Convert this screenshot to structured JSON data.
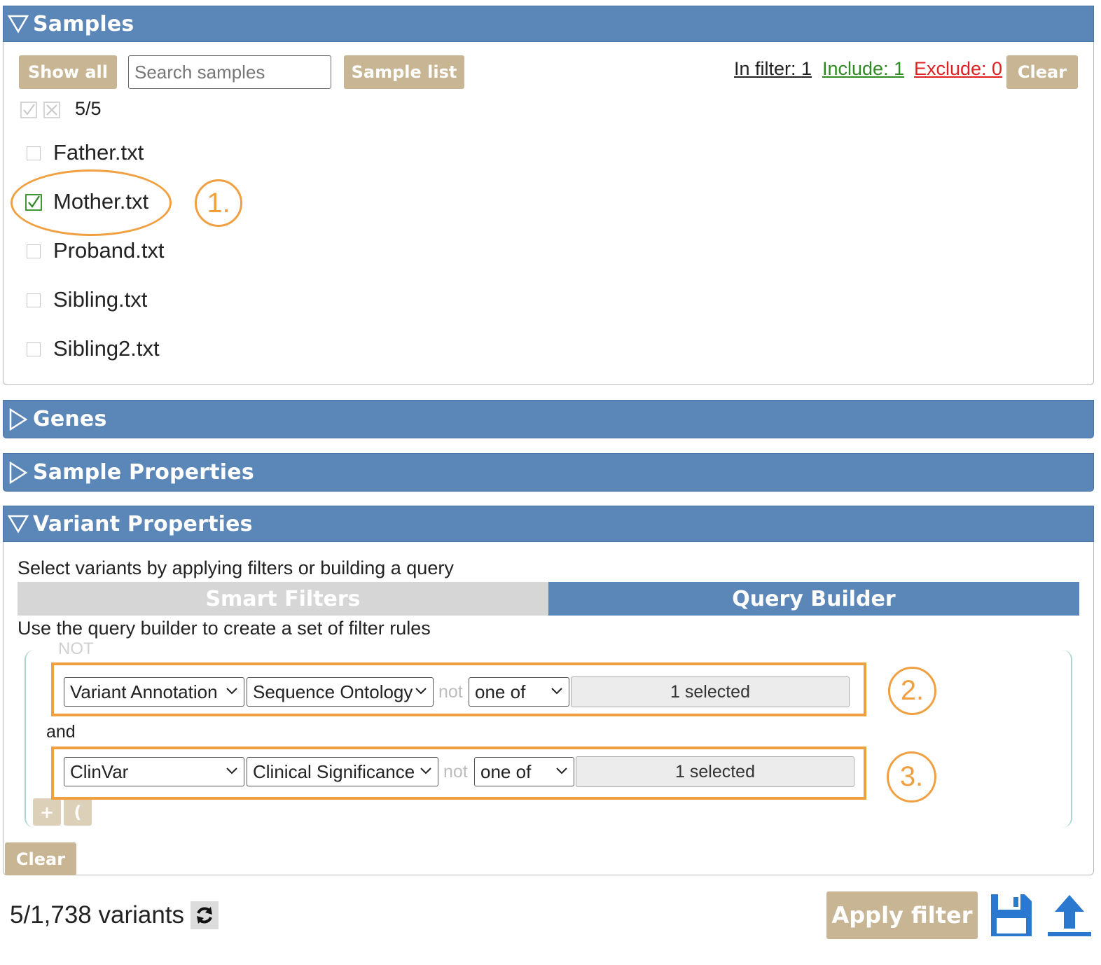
{
  "samples": {
    "title": "Samples",
    "show_all": "Show all",
    "search_placeholder": "Search samples",
    "sample_list": "Sample list",
    "in_filter": "In filter: 1",
    "include": "Include: 1",
    "exclude": "Exclude: 0",
    "clear": "Clear",
    "count": "5/5",
    "items": [
      {
        "label": "Father.txt",
        "checked": false
      },
      {
        "label": "Mother.txt",
        "checked": true
      },
      {
        "label": "Proband.txt",
        "checked": false
      },
      {
        "label": "Sibling.txt",
        "checked": false
      },
      {
        "label": "Sibling2.txt",
        "checked": false
      }
    ]
  },
  "genes": {
    "title": "Genes"
  },
  "sample_properties": {
    "title": "Sample Properties"
  },
  "variant_properties": {
    "title": "Variant Properties",
    "intro": "Select variants by applying filters or building a query",
    "tabs": [
      {
        "label": "Smart Filters",
        "active": false
      },
      {
        "label": "Query Builder",
        "active": true
      }
    ],
    "qb_intro": "Use the query builder to create a set of filter rules",
    "not_label": "NOT",
    "connector": "and",
    "rules": [
      {
        "category": "Variant Annotation",
        "field": "Sequence Ontology",
        "not": "not",
        "op": "one of",
        "value": "1 selected"
      },
      {
        "category": "ClinVar",
        "field": "Clinical Significance",
        "not": "not",
        "op": "one of",
        "value": "1 selected"
      }
    ],
    "add_rule": "+",
    "add_group": "(",
    "clear": "Clear"
  },
  "annotations": [
    "1.",
    "2.",
    "3."
  ],
  "footer": {
    "variants": "5/1,738 variants",
    "apply": "Apply filter"
  },
  "icons": {
    "refresh": "refresh-icon",
    "save": "save-icon",
    "upload": "upload-icon"
  },
  "colors": {
    "header_blue": "#5b86b8",
    "tan_button": "#c7b594",
    "annotation_orange": "#f0a040",
    "include_green": "#2e8b22",
    "exclude_red": "#e02020"
  }
}
